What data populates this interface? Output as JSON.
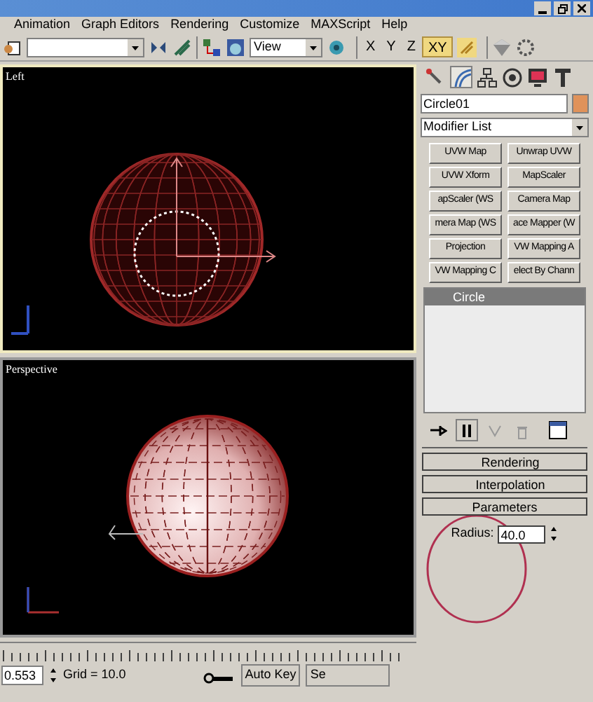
{
  "menu": [
    "Animation",
    "Graph Editors",
    "Rendering",
    "Customize",
    "MAXScript",
    "Help"
  ],
  "toolbar": {
    "reference_coord": "View",
    "axes": [
      {
        "label": "X",
        "selected": false
      },
      {
        "label": "Y",
        "selected": false
      },
      {
        "label": "Z",
        "selected": false
      },
      {
        "label": "XY",
        "selected": true
      }
    ]
  },
  "viewports": [
    {
      "label": "Left",
      "kind": "wireframe",
      "active": true
    },
    {
      "label": "Perspective",
      "kind": "shaded",
      "active": false
    }
  ],
  "command_panel": {
    "object_name": "Circle01",
    "modifier_list": "Modifier List",
    "modifier_buttons": [
      "UVW Map",
      "Unwrap UVW",
      "UVW Xform",
      "MapScaler",
      "apScaler (WS",
      "Camera Map",
      "mera Map (WS",
      "ace Mapper (W",
      "Projection",
      "VW Mapping A",
      "VW Mapping C",
      "elect By Chann"
    ],
    "stack": [
      {
        "label": "Circle",
        "selected": true
      }
    ],
    "rollouts": [
      {
        "label": "Rendering",
        "expanded": false
      },
      {
        "label": "Interpolation",
        "expanded": false
      },
      {
        "label": "Parameters",
        "expanded": true
      }
    ],
    "radius": {
      "label": "Radius:",
      "value": "40.0"
    }
  },
  "status_bar": {
    "coordinate": "0.553",
    "grid": "Grid = 10.0",
    "auto_key": "Auto Key",
    "set_key": "Se"
  }
}
